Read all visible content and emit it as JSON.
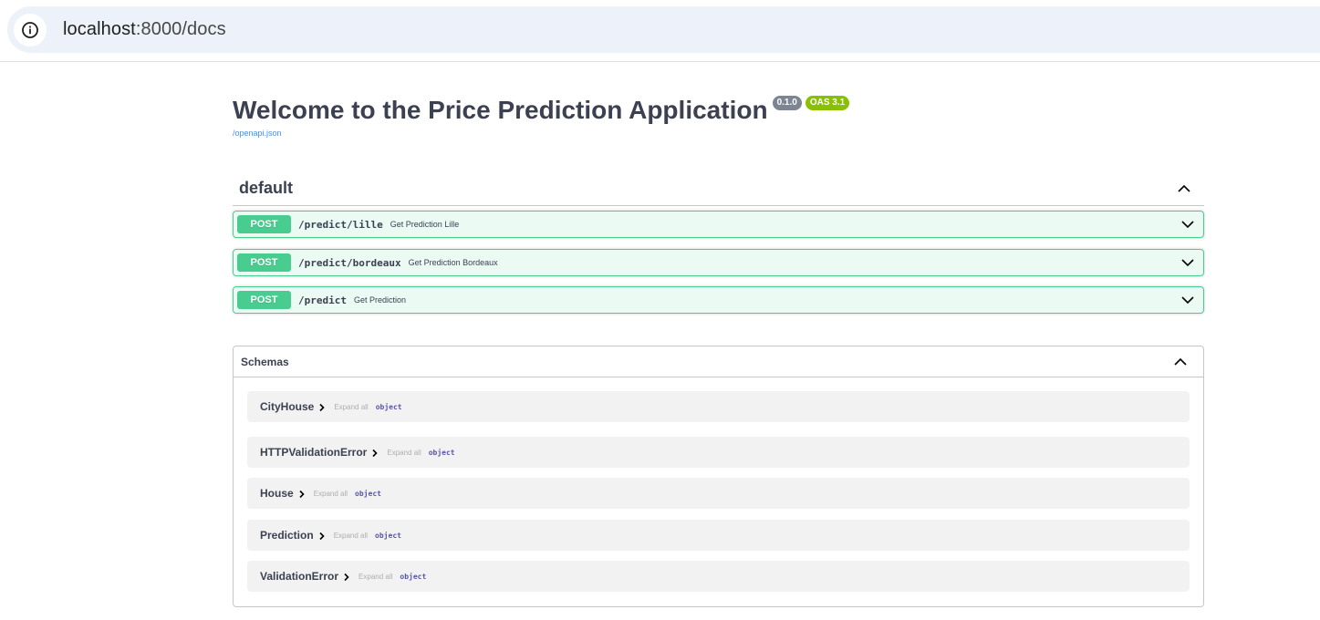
{
  "browser": {
    "url_host": "localhost",
    "url_rest": ":8000/docs",
    "icon": "info-icon"
  },
  "info": {
    "title": "Welcome to the Price Prediction Application",
    "version": "0.1.0",
    "oas": "OAS 3.1",
    "spec_link": "/openapi.json"
  },
  "tag": {
    "name": "default",
    "toggle_icon": "chevron-up-icon"
  },
  "operations": [
    {
      "method": "POST",
      "path": "/predict/lille",
      "summary": "Get Prediction Lille"
    },
    {
      "method": "POST",
      "path": "/predict/bordeaux",
      "summary": "Get Prediction Bordeaux"
    },
    {
      "method": "POST",
      "path": "/predict",
      "summary": "Get Prediction"
    }
  ],
  "schemas": {
    "title": "Schemas",
    "items": [
      {
        "name": "CityHouse",
        "expand": "Expand all",
        "type": "object"
      },
      {
        "name": "HTTPValidationError",
        "expand": "Expand all",
        "type": "object"
      },
      {
        "name": "House",
        "expand": "Expand all",
        "type": "object"
      },
      {
        "name": "Prediction",
        "expand": "Expand all",
        "type": "object"
      },
      {
        "name": "ValidationError",
        "expand": "Expand all",
        "type": "object"
      }
    ]
  },
  "colors": {
    "post": "#49cc90",
    "version_badge": "#7d8492",
    "oas_badge": "#89bf04",
    "link": "#4990e2"
  }
}
